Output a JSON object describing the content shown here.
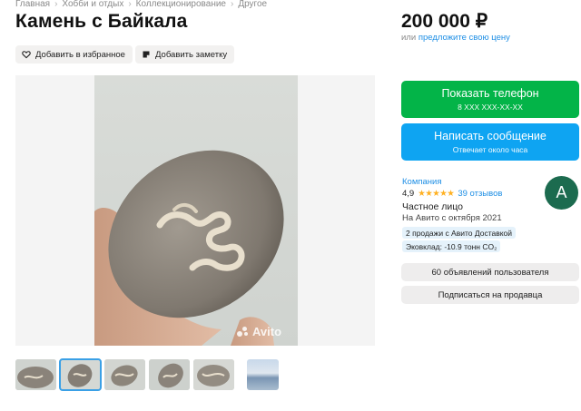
{
  "breadcrumb": [
    "Главная",
    "Хобби и отдых",
    "Коллекционирование",
    "Другое"
  ],
  "title": "Камень с Байкала",
  "actions": {
    "favorite_label": "Добавить в избранное",
    "note_label": "Добавить заметку"
  },
  "gallery": {
    "watermark": "Avito",
    "thumbnail_count": 6,
    "selected_thumbnail": 2
  },
  "price": {
    "value": "200 000 ₽",
    "or_text": "или",
    "offer_link": "предложите свою цену"
  },
  "contact": {
    "show_phone_label": "Показать телефон",
    "phone_masked": "8 ХХХ ХХХ-ХХ-ХХ",
    "message_label": "Написать сообщение",
    "response_time": "Отвечает около часа"
  },
  "seller": {
    "type": "Компания",
    "rating": "4,9",
    "reviews": "39 отзывов",
    "name": "Частное лицо",
    "since": "На Авито с октября 2021",
    "badge_sales": "2 продажи с Авито Доставкой",
    "badge_eco": "Эковклад: -10.9 тонн CO₂",
    "avatar_letter": "А",
    "listings_button": "60 объявлений пользователя",
    "subscribe_button": "Подписаться на продавца"
  },
  "colors": {
    "green": "#03b448",
    "blue": "#0ea4f2",
    "link": "#1f8fe5",
    "star": "#ffb021",
    "avatar": "#1c6b4f"
  }
}
